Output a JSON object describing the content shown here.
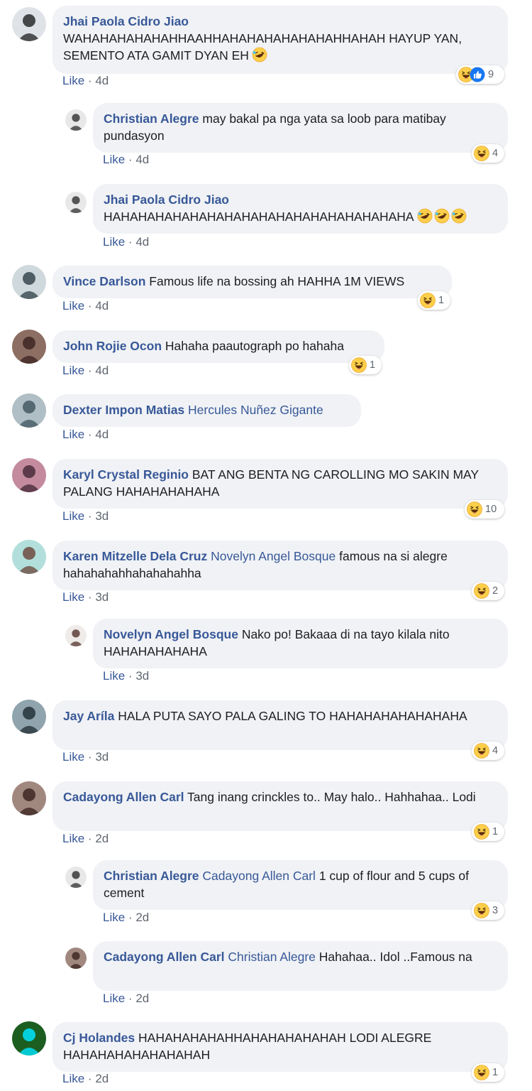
{
  "comments": [
    {
      "name": "Jhai Paola Cidro Jiao",
      "tag": "",
      "text": "WAHAHAHAHAHAHHAAHHAHAHAHAHAHAHAHHAHAH HAYUP YAN, SEMENTO ATA GAMIT DYAN EH",
      "emoji_count": 1,
      "like": "Like",
      "time": "4d",
      "reactions": "9",
      "reaction_types": [
        "haha-icon",
        "like-icon"
      ]
    },
    {
      "name": "Christian Alegre",
      "tag": "",
      "text": "may bakal pa nga yata sa loob para matibay pundasyon",
      "emoji_count": 0,
      "like": "Like",
      "time": "4d",
      "reactions": "4",
      "reaction_types": [
        "haha-icon"
      ]
    },
    {
      "name": "Jhai Paola Cidro Jiao",
      "tag": "",
      "text": "HAHAHAHAHAHAHAHAHAHAHAHAHAHAHAHAHAHA",
      "emoji_count": 3,
      "like": "Like",
      "time": "4d",
      "reactions": "",
      "reaction_types": []
    },
    {
      "name": "Vince Darlson",
      "tag": "",
      "text": "Famous life na bossing ah HAHHA 1M VIEWS",
      "emoji_count": 0,
      "like": "Like",
      "time": "4d",
      "reactions": "1",
      "reaction_types": [
        "haha-icon"
      ]
    },
    {
      "name": "John Rojie Ocon",
      "tag": "",
      "text": "Hahaha paautograph po hahaha",
      "emoji_count": 0,
      "like": "Like",
      "time": "4d",
      "reactions": "1",
      "reaction_types": [
        "haha-icon"
      ]
    },
    {
      "name": "Dexter Impon Matias",
      "tag": "Hercules Nuñez Gigante",
      "text": "",
      "emoji_count": 0,
      "like": "Like",
      "time": "4d",
      "reactions": "",
      "reaction_types": []
    },
    {
      "name": "Karyl Crystal Reginio",
      "tag": "",
      "text": "BAT ANG BENTA NG CAROLLING MO SAKIN MAY PALANG HAHAHAHAHAHA",
      "emoji_count": 0,
      "like": "Like",
      "time": "3d",
      "reactions": "10",
      "reaction_types": [
        "haha-icon"
      ]
    },
    {
      "name": "Karen Mitzelle Dela Cruz",
      "tag": "Novelyn Angel Bosque",
      "text": "famous na si alegre hahahahahhahahahahha",
      "emoji_count": 0,
      "like": "Like",
      "time": "3d",
      "reactions": "2",
      "reaction_types": [
        "haha-icon"
      ]
    },
    {
      "name": "Novelyn Angel Bosque",
      "tag": "",
      "text": "Nako po! Bakaaa di na tayo kilala nito HAHAHAHAHAHA",
      "emoji_count": 0,
      "like": "Like",
      "time": "3d",
      "reactions": "",
      "reaction_types": []
    },
    {
      "name": "Jay Aríla",
      "tag": "",
      "text": "HALA PUTA SAYO PALA GALING TO HAHAHAHAHAHAHAHA",
      "emoji_count": 0,
      "like": "Like",
      "time": "3d",
      "reactions": "4",
      "reaction_types": [
        "haha-icon"
      ]
    },
    {
      "name": "Cadayong Allen Carl",
      "tag": "",
      "text": "Tang inang crinckles to.. May halo.. Hahhahaa.. Lodi",
      "emoji_count": 0,
      "like": "Like",
      "time": "2d",
      "reactions": "1",
      "reaction_types": [
        "haha-icon"
      ]
    },
    {
      "name": "Christian Alegre",
      "tag": "Cadayong Allen Carl",
      "text": "1 cup of flour and 5 cups of cement",
      "emoji_count": 0,
      "like": "Like",
      "time": "2d",
      "reactions": "3",
      "reaction_types": [
        "haha-icon"
      ]
    },
    {
      "name": "Cadayong Allen Carl",
      "tag": "Christian Alegre",
      "text": "Hahahaa.. Idol ..Famous na",
      "emoji_count": 0,
      "like": "Like",
      "time": "2d",
      "reactions": "",
      "reaction_types": []
    },
    {
      "name": "Cj Holandes",
      "tag": "",
      "text": "HAHAHAHAHAHHAHAHAHAHAHAH LODI ALEGRE HAHAHAHAHAHAHAHAH",
      "emoji_count": 0,
      "like": "Like",
      "time": "2d",
      "reactions": "1",
      "reaction_types": [
        "haha-icon"
      ]
    }
  ],
  "meta_separator": "·",
  "colors": {
    "name": "#385898",
    "bubble": "#f0f2f5",
    "text": "#1c1e21",
    "meta": "#606770",
    "haha": "#fcd34d",
    "like": "#1877f2"
  }
}
